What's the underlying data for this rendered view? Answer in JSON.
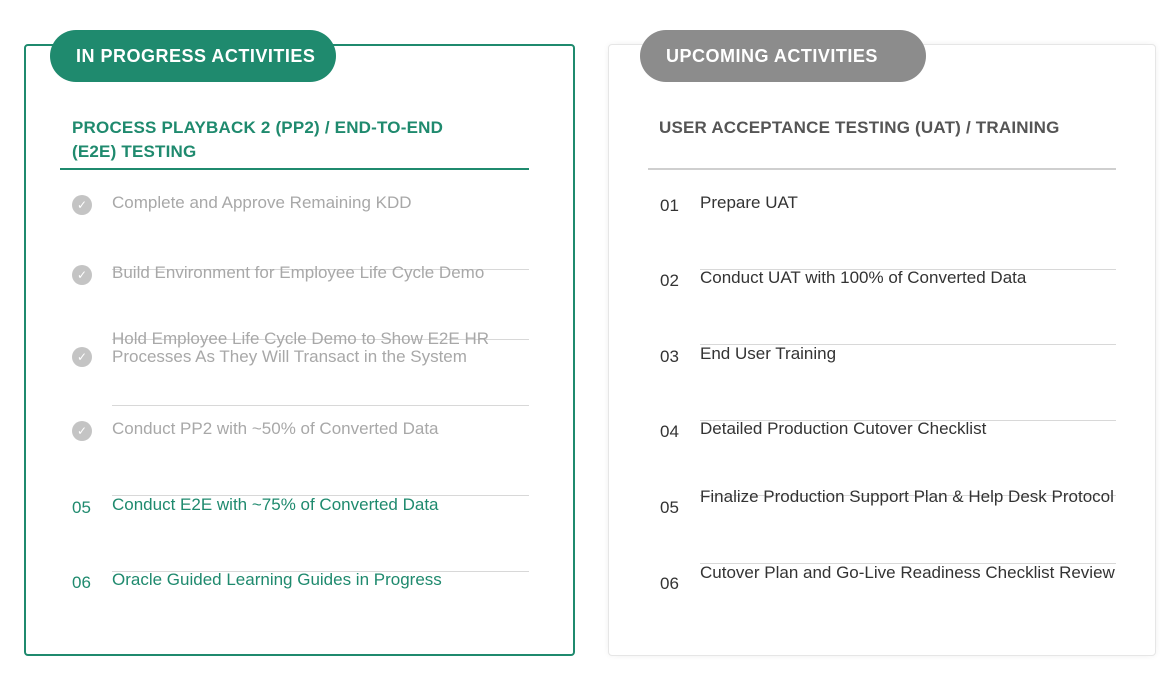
{
  "in_progress": {
    "header": "IN PROGRESS ACTIVITIES",
    "title": "PROCESS PLAYBACK 2 (PP2) / END-TO-END (E2E) TESTING",
    "items": [
      {
        "marker": "check",
        "label": "Complete and Approve Remaining KDD",
        "status": "done"
      },
      {
        "marker": "check",
        "label": "Build Environment for Employee Life Cycle Demo",
        "status": "done"
      },
      {
        "marker": "check",
        "label": "Hold Employee Life Cycle Demo to Show E2E HR Processes As They Will Transact in the System",
        "status": "done"
      },
      {
        "marker": "check",
        "label": "Conduct PP2 with ~50% of Converted Data",
        "status": "done"
      },
      {
        "marker": "05",
        "label": "Conduct E2E with ~75% of Converted Data",
        "status": "active"
      },
      {
        "marker": "06",
        "label": "Oracle Guided Learning Guides in Progress",
        "status": "active"
      }
    ]
  },
  "upcoming": {
    "header": "UPCOMING ACTIVITIES",
    "title": "USER ACCEPTANCE TESTING (UAT) / TRAINING",
    "items": [
      {
        "marker": "01",
        "label": "Prepare UAT"
      },
      {
        "marker": "02",
        "label": "Conduct UAT with 100% of Converted Data"
      },
      {
        "marker": "03",
        "label": "End User Training"
      },
      {
        "marker": "04",
        "label": "Detailed Production Cutover Checklist"
      },
      {
        "marker": "05",
        "label": "Finalize Production Support Plan & Help Desk Protocol"
      },
      {
        "marker": "06",
        "label": "Cutover Plan and Go-Live Readiness Checklist Review"
      }
    ]
  },
  "colors": {
    "accent": "#1f8a6e",
    "muted": "#8c8c8c",
    "done_text": "#a8a8a8"
  },
  "icons": {
    "done": "check-circle-icon"
  }
}
